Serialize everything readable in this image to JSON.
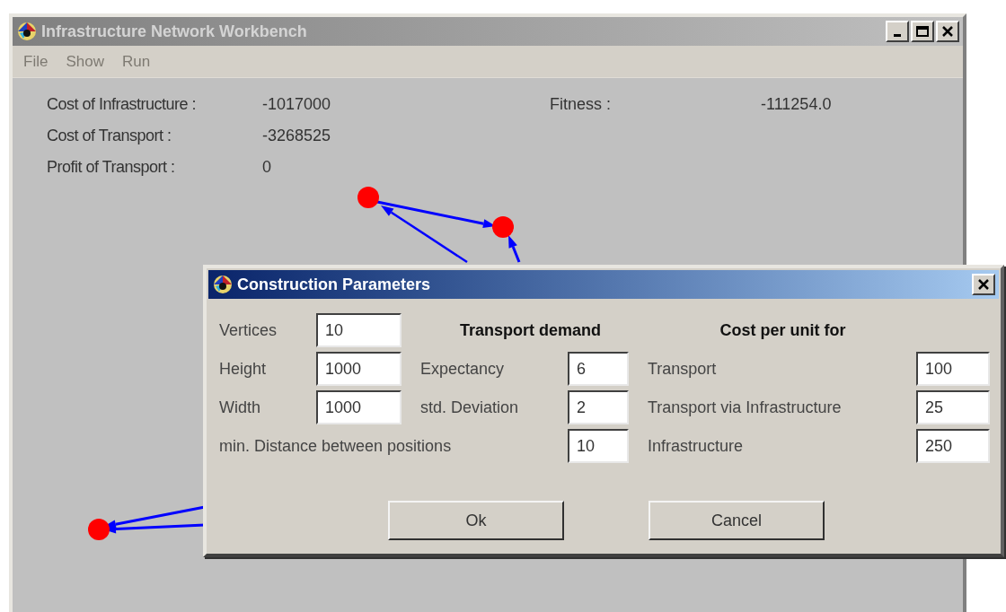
{
  "window": {
    "title": "Infrastructure Network Workbench"
  },
  "menu": [
    {
      "label": "File",
      "disabled": true
    },
    {
      "label": "Show",
      "disabled": true
    },
    {
      "label": "Run",
      "disabled": true
    }
  ],
  "stats": [
    {
      "label": "Cost of Infrastructure :",
      "value": "-1017000"
    },
    {
      "label": "Cost of Transport :",
      "value": "-3268525"
    },
    {
      "label": "Profit of Transport :",
      "value": "0"
    }
  ],
  "fitness": {
    "label": "Fitness :",
    "value": "-111254.0"
  },
  "dialog": {
    "title": "Construction Parameters",
    "size_fields": [
      {
        "label": "Vertices",
        "value": "10"
      },
      {
        "label": "Height",
        "value": "1000"
      },
      {
        "label": "Width",
        "value": "1000"
      }
    ],
    "demand_heading": "Transport demand",
    "demand_fields": [
      {
        "label": "Expectancy",
        "value": "6"
      },
      {
        "label": "std. Deviation",
        "value": "2"
      }
    ],
    "distance_field": {
      "label": "min. Distance between positions",
      "value": "10"
    },
    "cost_heading": "Cost per unit for",
    "cost_fields": [
      {
        "label": "Transport",
        "value": "100"
      },
      {
        "label": "Transport via Infrastructure",
        "value": "25"
      },
      {
        "label": "Infrastructure",
        "value": "250"
      }
    ],
    "buttons": [
      "Ok",
      "Cancel"
    ]
  }
}
